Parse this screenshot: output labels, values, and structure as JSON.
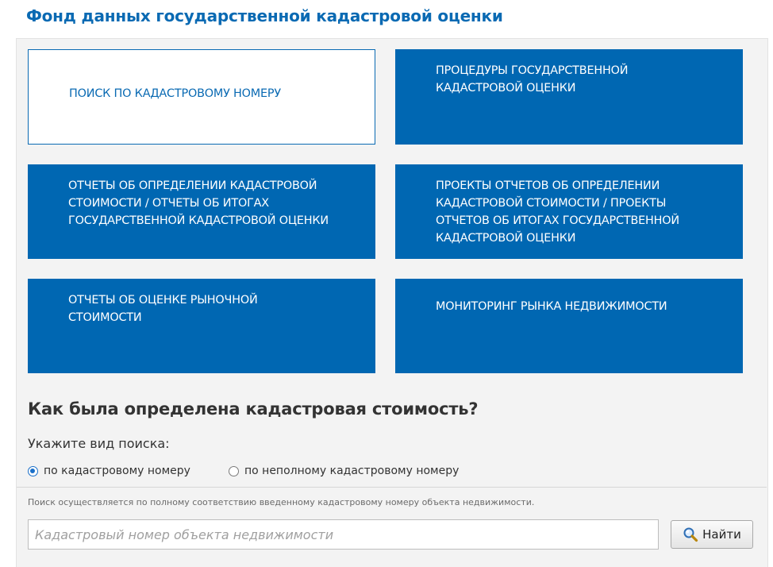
{
  "header": {
    "title": "Фонд данных государственной кадастровой оценки"
  },
  "tiles": [
    {
      "label": "ПОИСК ПО КАДАСТРОВОМУ НОМЕРУ"
    },
    {
      "label": "ПРОЦЕДУРЫ ГОСУДАРСТВЕННОЙ КАДАСТРОВОЙ ОЦЕНКИ"
    },
    {
      "label": "ОТЧЕТЫ ОБ ОПРЕДЕЛЕНИИ КАДАСТРОВОЙ СТОИМОСТИ / ОТЧЕТЫ ОБ ИТОГАХ ГОСУДАРСТВЕННОЙ КАДАСТРОВОЙ ОЦЕНКИ"
    },
    {
      "label": "ПРОЕКТЫ ОТЧЕТОВ ОБ ОПРЕДЕЛЕНИИ КАДАСТРОВОЙ СТОИМОСТИ / ПРОЕКТЫ ОТЧЕТОВ ОБ ИТОГАХ ГОСУДАРСТВЕННОЙ КАДАСТРОВОЙ ОЦЕНКИ"
    },
    {
      "label": "ОТЧЕТЫ ОБ ОЦЕНКЕ РЫНОЧНОЙ СТОИМОСТИ"
    },
    {
      "label": "МОНИТОРИНГ РЫНКА НЕДВИЖИМОСТИ"
    }
  ],
  "search": {
    "section_title": "Как была определена кадастровая стоимость?",
    "kind_label": "Укажите вид поиска:",
    "options": [
      {
        "label": "по кадастровому номеру",
        "selected": true
      },
      {
        "label": "по неполному кадастровому номеру",
        "selected": false
      }
    ],
    "hint": "Поиск осуществляется по полному соответствию введенному кадастровому номеру объекта недвижимости.",
    "placeholder": "Кадастровый номер объекта недвижимости",
    "value": "",
    "button_label": "Найти",
    "button_icon": "magnifier-icon"
  },
  "colors": {
    "brand_blue": "#0067b2",
    "title_blue": "#0a6ab3",
    "panel_bg": "#f3f3f3",
    "radio_accent": "#1a6fc9"
  }
}
